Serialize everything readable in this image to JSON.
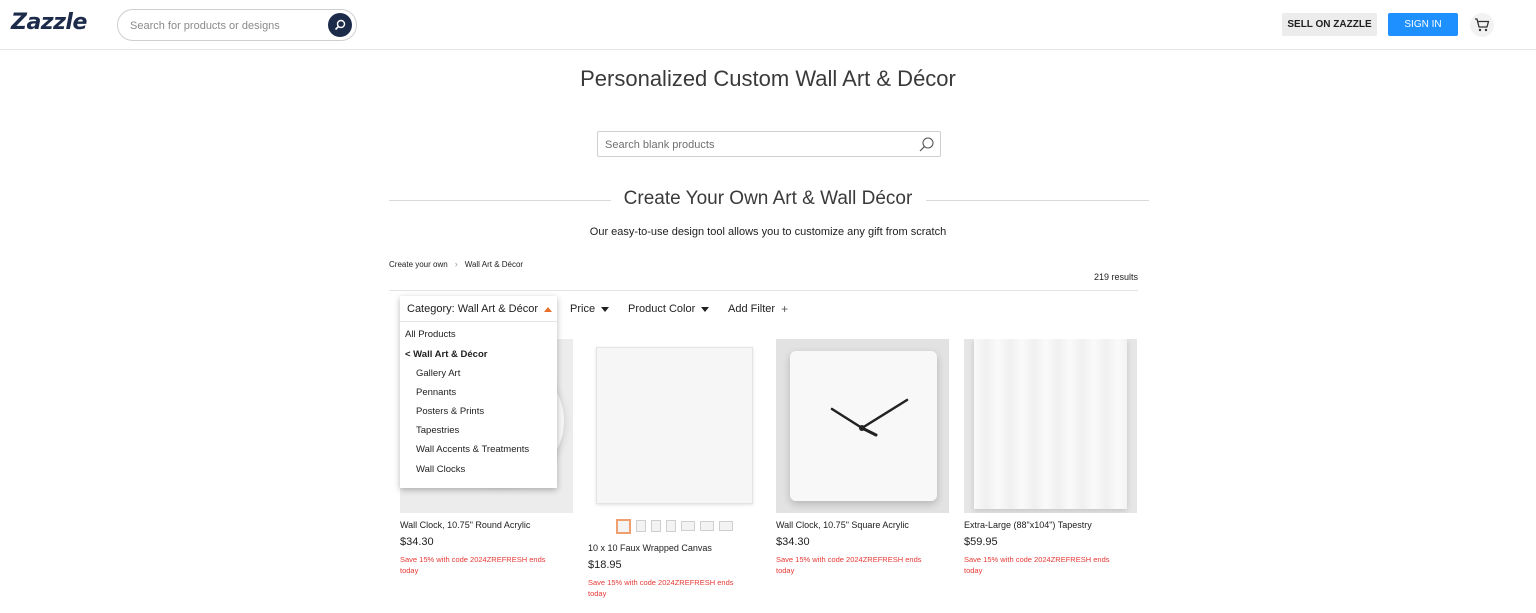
{
  "header": {
    "logo": "Zazzle",
    "search_placeholder": "Search for products or designs",
    "sell_label": "SELL ON ZAZZLE",
    "signin_label": "SIGN IN",
    "accent_color": "#1e90ff",
    "brand_color": "#1c2b4a"
  },
  "page": {
    "title": "Personalized Custom Wall Art & Décor",
    "blank_search_placeholder": "Search blank products",
    "section_title": "Create Your Own Art & Wall Décor",
    "section_subtitle": "Our easy-to-use design tool allows you to customize any gift from scratch"
  },
  "breadcrumb": [
    "Create your own",
    "Wall Art & Décor"
  ],
  "results_label": "219 results",
  "filters": {
    "category": "Category: Wall Art & Décor",
    "price": "Price",
    "color": "Product Color",
    "add": "Add Filter",
    "add_icon": "plus-icon"
  },
  "dropdown": {
    "all": "All Products",
    "current": "< Wall Art & Décor",
    "items": [
      "Gallery Art",
      "Pennants",
      "Posters & Prints",
      "Tapestries",
      "Wall Accents & Treatments",
      "Wall Clocks"
    ]
  },
  "products": [
    {
      "name": "Wall Clock, 10.75\" Round Acrylic",
      "price": "$34.30",
      "promo": "Save 15% with code 2024ZREFRESH ends today"
    },
    {
      "name": "10 x 10 Faux Wrapped Canvas",
      "price": "$18.95",
      "promo": "Save 15% with code 2024ZREFRESH ends today"
    },
    {
      "name": "Wall Clock, 10.75\" Square Acrylic",
      "price": "$34.30",
      "promo": "Save 15% with code 2024ZREFRESH ends today"
    },
    {
      "name": "Extra-Large (88\"x104\") Tapestry",
      "price": "$59.95",
      "promo": "Save 15% with code 2024ZREFRESH ends today"
    }
  ],
  "promo_color": "#e53935"
}
